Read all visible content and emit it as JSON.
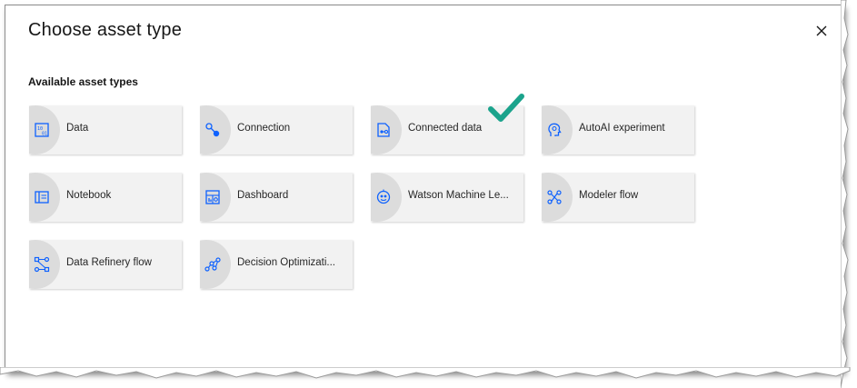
{
  "dialog": {
    "title": "Choose asset type",
    "close_icon": "close-icon"
  },
  "section": {
    "label": "Available asset types"
  },
  "tiles": [
    {
      "label": "Data",
      "icon": "data-icon"
    },
    {
      "label": "Connection",
      "icon": "connection-icon"
    },
    {
      "label": "Connected data",
      "icon": "connected-data-icon"
    },
    {
      "label": "AutoAI experiment",
      "icon": "autoai-icon"
    },
    {
      "label": "Notebook",
      "icon": "notebook-icon"
    },
    {
      "label": "Dashboard",
      "icon": "dashboard-icon"
    },
    {
      "label": "Watson Machine Le...",
      "icon": "watson-ml-icon"
    },
    {
      "label": "Modeler flow",
      "icon": "modeler-flow-icon"
    },
    {
      "label": "Data Refinery flow",
      "icon": "data-refinery-icon"
    },
    {
      "label": "Decision Optimizati...",
      "icon": "decision-optimization-icon"
    }
  ],
  "annotation": {
    "icon": "checkmark-icon",
    "color": "#1ba38c"
  },
  "colors": {
    "icon_blue": "#0f62fe",
    "tile_bg": "#f2f2f2",
    "tile_circle": "#dcdcdc"
  }
}
